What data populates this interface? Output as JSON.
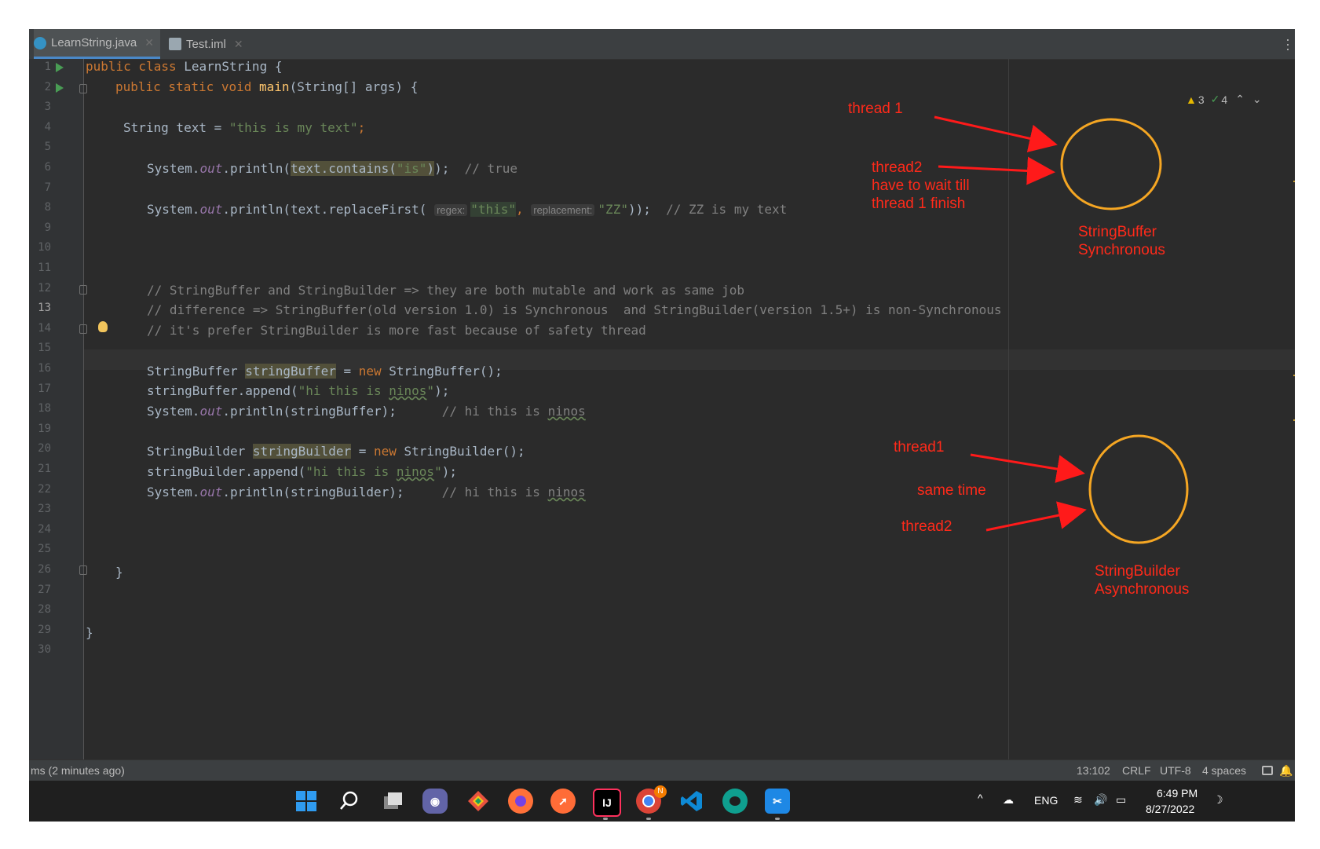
{
  "tabs": [
    {
      "label": "LearnString.java",
      "icon": "java-class-icon",
      "active": true
    },
    {
      "label": "Test.iml",
      "icon": "file-icon",
      "active": false
    }
  ],
  "inspection": {
    "warnings": "3",
    "weak_warnings": "4"
  },
  "line_numbers": [
    "1",
    "2",
    "3",
    "4",
    "5",
    "6",
    "7",
    "8",
    "9",
    "10",
    "11",
    "12",
    "13",
    "14",
    "15",
    "16",
    "17",
    "18",
    "19",
    "20",
    "21",
    "22",
    "23",
    "24",
    "25",
    "26",
    "27",
    "28",
    "29",
    "30"
  ],
  "current_line": "13",
  "code": {
    "l1": {
      "kw": "public class ",
      "rest": "LearnString {"
    },
    "l2": {
      "kw": "public static void ",
      "fn": "main",
      "rest": "(String[] args) {"
    },
    "l4": {
      "pre": "String text = ",
      "str": "\"this is my text\"",
      "end": ";"
    },
    "l6": {
      "pre": "System.",
      "out": "out",
      "mid": ".println(",
      "hl": "text.contains(",
      "str": "\"is\"",
      "hl2": ")",
      "end": ");  ",
      "cm": "// true"
    },
    "l8": {
      "pre": "System.",
      "out": "out",
      "mid": ".println(text.replaceFirst( ",
      "hint1": "regex:",
      "str1": "\"this\"",
      "comma": ", ",
      "hint2": "replacement:",
      "str2": "\"ZZ\"",
      "end": "));  ",
      "cm": "// ZZ is my text"
    },
    "l12": "// StringBuffer and StringBuilder => they are both mutable and work as same job",
    "l13": "// difference => StringBuffer(old version 1.0) is Synchronous  and StringBuilder(version 1.5+) is non-Synchronous",
    "l14": "// it's prefer StringBuilder is more fast because of safety thread",
    "l16": {
      "pre": "StringBuffer ",
      "var": "stringBuffer",
      "mid": " = ",
      "kw": "new ",
      "rest": "StringBuffer();"
    },
    "l17": {
      "pre": "stringBuffer.append(",
      "str": "\"hi this is ",
      "wavy": "ninos",
      "strend": "\"",
      "end": ");"
    },
    "l18": {
      "pre": "System.",
      "out": "out",
      "mid": ".println(stringBuffer);      ",
      "cm": "// hi this is ",
      "wavy": "ninos"
    },
    "l20": {
      "pre": "StringBuilder ",
      "var": "stringBuilder",
      "mid": " = ",
      "kw": "new ",
      "rest": "StringBuilder();"
    },
    "l21": {
      "pre": "stringBuilder.append(",
      "str": "\"hi this is ",
      "wavy": "ninos",
      "strend": "\"",
      "end": ");"
    },
    "l22": {
      "pre": "System.",
      "out": "out",
      "mid": ".println(stringBuilder);     ",
      "cm": "// hi this is ",
      "wavy": "ninos"
    },
    "l26": "}",
    "l29": "}"
  },
  "annotations": {
    "thread1_top": "thread 1",
    "thread2_top_lines": [
      "thread2",
      "have to wait till",
      "thread 1 finish"
    ],
    "buffer_label": [
      "StringBuffer",
      "Synchronous"
    ],
    "thread1_bottom": "thread1",
    "same_time": "same time",
    "thread2_bottom": "thread2",
    "builder_label": [
      "StringBuilder",
      "Asynchronous"
    ],
    "color_text": "#ff2a1a",
    "color_circle": "#f5a623"
  },
  "status_bar": {
    "left": "ms (2 minutes ago)",
    "position": "13:102",
    "line_sep": "CRLF",
    "encoding": "UTF-8",
    "indent": "4 spaces"
  },
  "taskbar": {
    "apps": [
      "windows-start",
      "search",
      "task-view",
      "teams-chat",
      "git",
      "firefox",
      "postman",
      "intellij",
      "chrome",
      "vscode",
      "edge",
      "snipping-tool"
    ],
    "chrome_badge": "N",
    "intellij_label": "IJ",
    "language": "ENG",
    "time": "6:49 PM",
    "date": "8/27/2022"
  },
  "colors": {
    "editor_bg": "#2b2b2b",
    "keyword": "#cc7832",
    "string": "#6a8759",
    "comment": "#808080"
  }
}
